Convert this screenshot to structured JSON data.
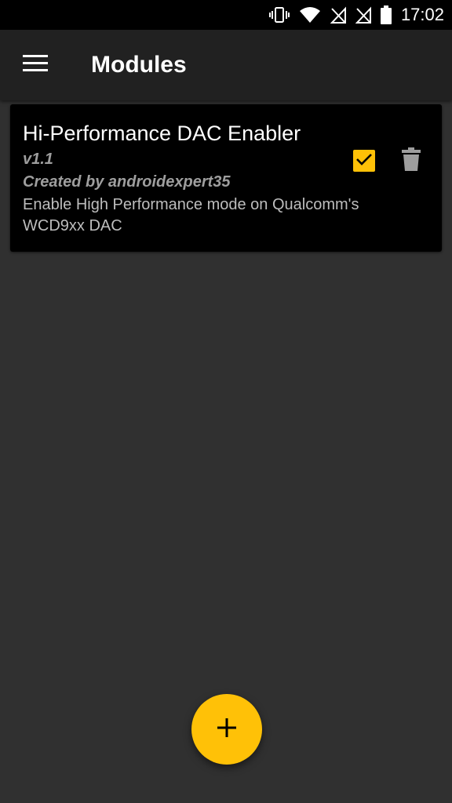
{
  "status_bar": {
    "time": "17:02",
    "icons": [
      "vibrate-icon",
      "wifi-icon",
      "sim-1-no-signal-icon",
      "sim-2-no-signal-icon",
      "battery-icon"
    ]
  },
  "app_bar": {
    "title": "Modules",
    "menu_icon": "hamburger-menu-icon"
  },
  "modules": [
    {
      "name": "Hi-Performance DAC Enabler",
      "version": "v1.1",
      "author": "Created by androidexpert35",
      "description": "Enable High Performance mode on Qualcomm's WCD9xx DAC",
      "enabled": true
    }
  ],
  "fab": {
    "icon": "plus-icon"
  },
  "colors": {
    "accent": "#ffc107",
    "background": "#303030",
    "app_bar": "#212121",
    "card": "#000000",
    "secondary_text": "#9e9e9e"
  }
}
